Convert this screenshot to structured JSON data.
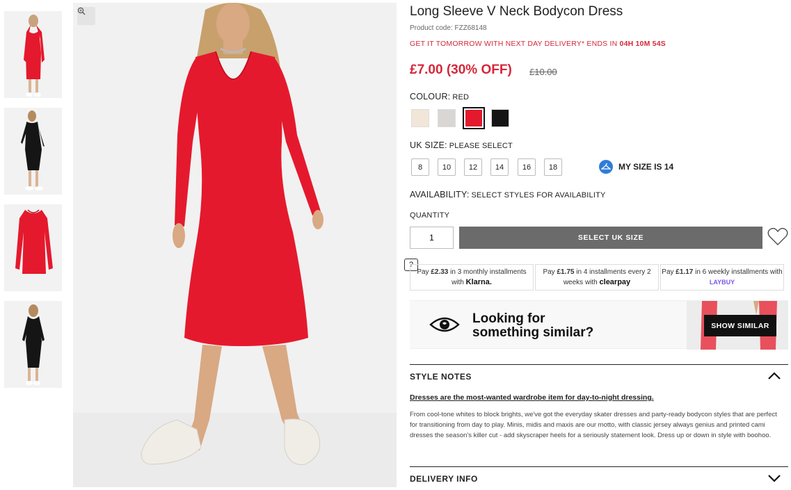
{
  "product": {
    "title": "Long Sleeve V Neck Bodycon Dress",
    "code": "Product code: FZZ68148",
    "delivery_text": "GET IT TOMORROW WITH NEXT DAY DELIVERY* ENDS IN",
    "delivery_countdown": "04H 10M 54S",
    "price": "£7.00 (30% OFF)",
    "old_price": "£10.00"
  },
  "colour": {
    "label": "COLOUR:",
    "value": "RED",
    "swatches": [
      {
        "name": "Cream",
        "hex": "#f1e6d8"
      },
      {
        "name": "Grey",
        "hex": "#d9d6d3"
      },
      {
        "name": "Red",
        "hex": "#e5192d",
        "selected": true
      },
      {
        "name": "Black",
        "hex": "#151515"
      }
    ]
  },
  "size": {
    "label": "UK SIZE:",
    "value": "PLEASE SELECT",
    "options": [
      "8",
      "10",
      "12",
      "14",
      "16",
      "18"
    ],
    "my_size": "MY SIZE IS 14"
  },
  "availability": {
    "label": "AVAILABILITY:",
    "value": "SELECT STYLES FOR AVAILABILITY"
  },
  "quantity": {
    "label": "QUANTITY",
    "value": "1",
    "button": "SELECT UK SIZE"
  },
  "payments": [
    {
      "pre": "Pay",
      "amount": "£2.33",
      "mid": "in 3 monthly installments with",
      "brand": "Klarna."
    },
    {
      "pre": "Pay",
      "amount": "£1.75",
      "mid": "in 4 installments every 2 weeks with",
      "brand": "clearpay"
    },
    {
      "pre": "Pay",
      "amount": "£1.17",
      "mid": "in 6 weekly installments with",
      "brand": "LAYBUY"
    }
  ],
  "help_label": "?",
  "similar": {
    "line1": "Looking for",
    "line2": "something similar?",
    "button": "SHOW SIMILAR"
  },
  "style_notes": {
    "title": "STYLE NOTES",
    "headline": "Dresses are the most-wanted wardrobe item for day-to-night dressing.",
    "body": "From cool-tone whites to block brights, we've got the everyday skater dresses and party-ready bodycon styles that are perfect for transitioning from day to play. Minis, midis and maxis are our motto, with classic jersey always genius and printed cami dresses the season's killer cut - add skyscraper heels for a seriously statement look. Dress up or down in style with boohoo."
  },
  "delivery_info": {
    "title": "DELIVERY INFO"
  },
  "icons": [
    "zoom-icon",
    "heart-icon",
    "hanger-icon",
    "eye-icon",
    "chevron-up-icon",
    "chevron-down-icon"
  ]
}
